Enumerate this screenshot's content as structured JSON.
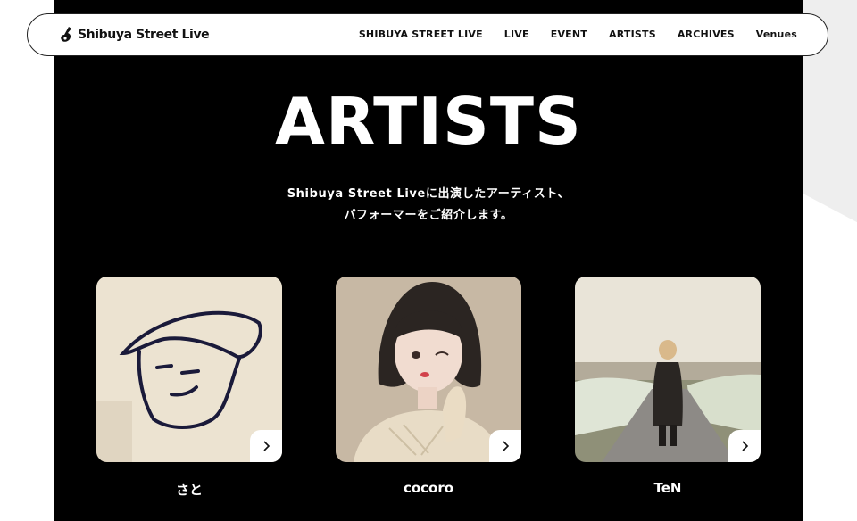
{
  "header": {
    "logo_text": "Shibuya Street Live",
    "nav": [
      "SHIBUYA STREET LIVE",
      "LIVE",
      "EVENT",
      "ARTISTS",
      "ARCHIVES",
      "Venues"
    ]
  },
  "page": {
    "title": "ARTISTS",
    "intro_line1": "Shibuya Street Liveに出演したアーティスト、",
    "intro_line2": "パフォーマーをご紹介します。"
  },
  "artists": [
    {
      "name": "さと",
      "icon": "chevron-right-icon"
    },
    {
      "name": "cocoro",
      "icon": "chevron-right-icon"
    },
    {
      "name": "TeN",
      "icon": "chevron-right-icon"
    }
  ]
}
